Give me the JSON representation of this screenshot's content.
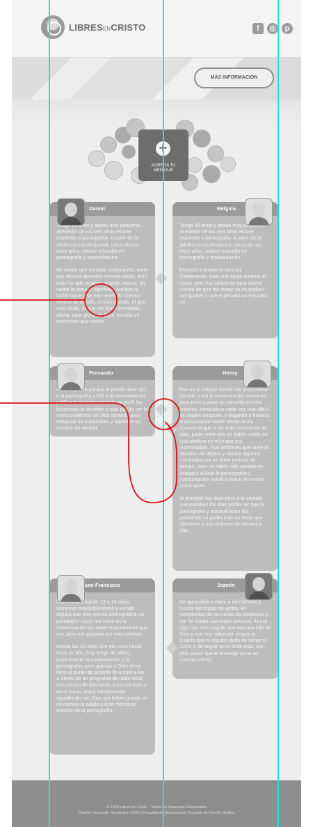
{
  "header": {
    "logo_primary": "LIBRES",
    "logo_small": "EN",
    "logo_secondary": "CRISTO",
    "social_icons": [
      "facebook-icon",
      "instagram-icon",
      "pinterest-icon"
    ]
  },
  "hero": {
    "button_label": "MÁS INFORMACION"
  },
  "message": {
    "plus": "+",
    "label": "AGREGA TU MENSAJE"
  },
  "testimonials": [
    {
      "name": "Daniel",
      "paragraphs": [
        "Tengo 33 años y desde muy pequeño, alrededor de los seis años estuve expuesto a pornografía. A partir de la adolescencia temprana, cerca de los once años, estuve envuelto en pornografía y masturbación.",
        "He tenido que cambiar costumbres, tener que desear aprender nuevas cosas, pero todo ha sido positivo, grande, nuevo, ha valido la pena el sacrificio. Aunque la lucha sigue y se han revelado nuevos frentes de batalla, el más grande, el que más costó, el que me tenía derrotado, ahora, para gloria de Dios, es sólo un testimonio que contar."
      ]
    },
    {
      "name": "Bélgica",
      "paragraphs": [
        "Tengo 33 años y desde muy pequeño, alrededor de los seis años estuve expuesto a pornografía. A partir de la adolescencia temprana, cerca de los once años, estuve envuelto en pornografía y masturbación.",
        "Empecé a probar la libertad. Ciertamente, tuve una caída durante el curso, pero fue suficiente para darme cuenta de que las cosas ya no podían ser iguales y que el pecado no era para mí."
      ]
    },
    {
      "name": "Fernando",
      "paragraphs": [
        "Al fin soy libre porque le puedo decir NO a la pornografía y NO a la masturbación y NO a la lascivia con todo mi ser!!! las fortalezas se derriban y casi puedo ver la mano poderosa de Dios obrando para restaurar mi matrimonio y hacerme un hombre de verdad."
      ]
    },
    {
      "name": "Henry",
      "paragraphs": [
        "Fue en el colegio donde me propusieron hacerlo y era la travesura del momento, pero poco a poco se convirtió en una práctica, tomándose cada vez más difícil de dejarlo después, y llegando a hacerlo ansiosamente varias veces al día. Cuando llegué a ser más consciente de esto, pude notar que se había vuelto en una atadura en mí y que era incontrolable. Fue entonces que tomé la decisión de dejarlo y obtuve algunos resultados por un buen periodo de tiempo, pero no había sido sanado en verdad y al final la pornografía y masturbación volvió a tomar el control como antes.",
        "Al principio fue duro pero a la medida que pasaban los días podía ver que la pornografía y masturbación iba perdiendo su poder y ya no tenía que obedecer a sus órdenes de recurrir a ella."
      ]
    },
    {
      "name": "Juan Francisco",
      "paragraphs": [
        "Como a la edad de 13 o 14 años comencé masturbándome y viendo alguna que otra revista pornográfica, es paradójico como me inicie en la masturbación sin saber exactamente que era, pero me gustaba por eso continué.",
        "Desde los 25 años que me case hasta hace un año (hoy tengo 30 años), experimente la masturbación y la pornografía, pero gracias a Dios el me llevo al punto de ponerle fin a esto y fue a través de un programa de radio local, que conocí de libertando a los cautivos y de el curso, estoy infinitamente agradecido con Dios por haber puesto en mi camino la salida a este monstruo horrible de la pornografía."
      ]
    },
    {
      "name": "Jazmín",
      "paragraphs": [
        "He aprendido a morir a mis deseos y buscar las cosas de arriba. Mi perspectiva de las cosas ha cambiado y me he vuelto una mejor persona. Ahora digo con todo orgullo que soy una hija de Dios y que soy salva por su gracia. Espero que si alguien duda de tomar el curso o de seguir no lo dude más, son sólo cosas que el enemigo pone en nuestra mente."
      ]
    }
  ],
  "footer": {
    "line1": "© 2020 Libres en Cristo - Todos los Derechos Reservados",
    "line2": "Diseño: Fernando Grosjean | USAC | Facultad de Arquitectura | Escuela de Diseño Gráfico"
  },
  "colors": {
    "guide_cyan": "#15e6e6",
    "annotation_red": "#dd1111",
    "card_gray": "#bdbdbd",
    "footer_gray": "#8e8e8e"
  }
}
